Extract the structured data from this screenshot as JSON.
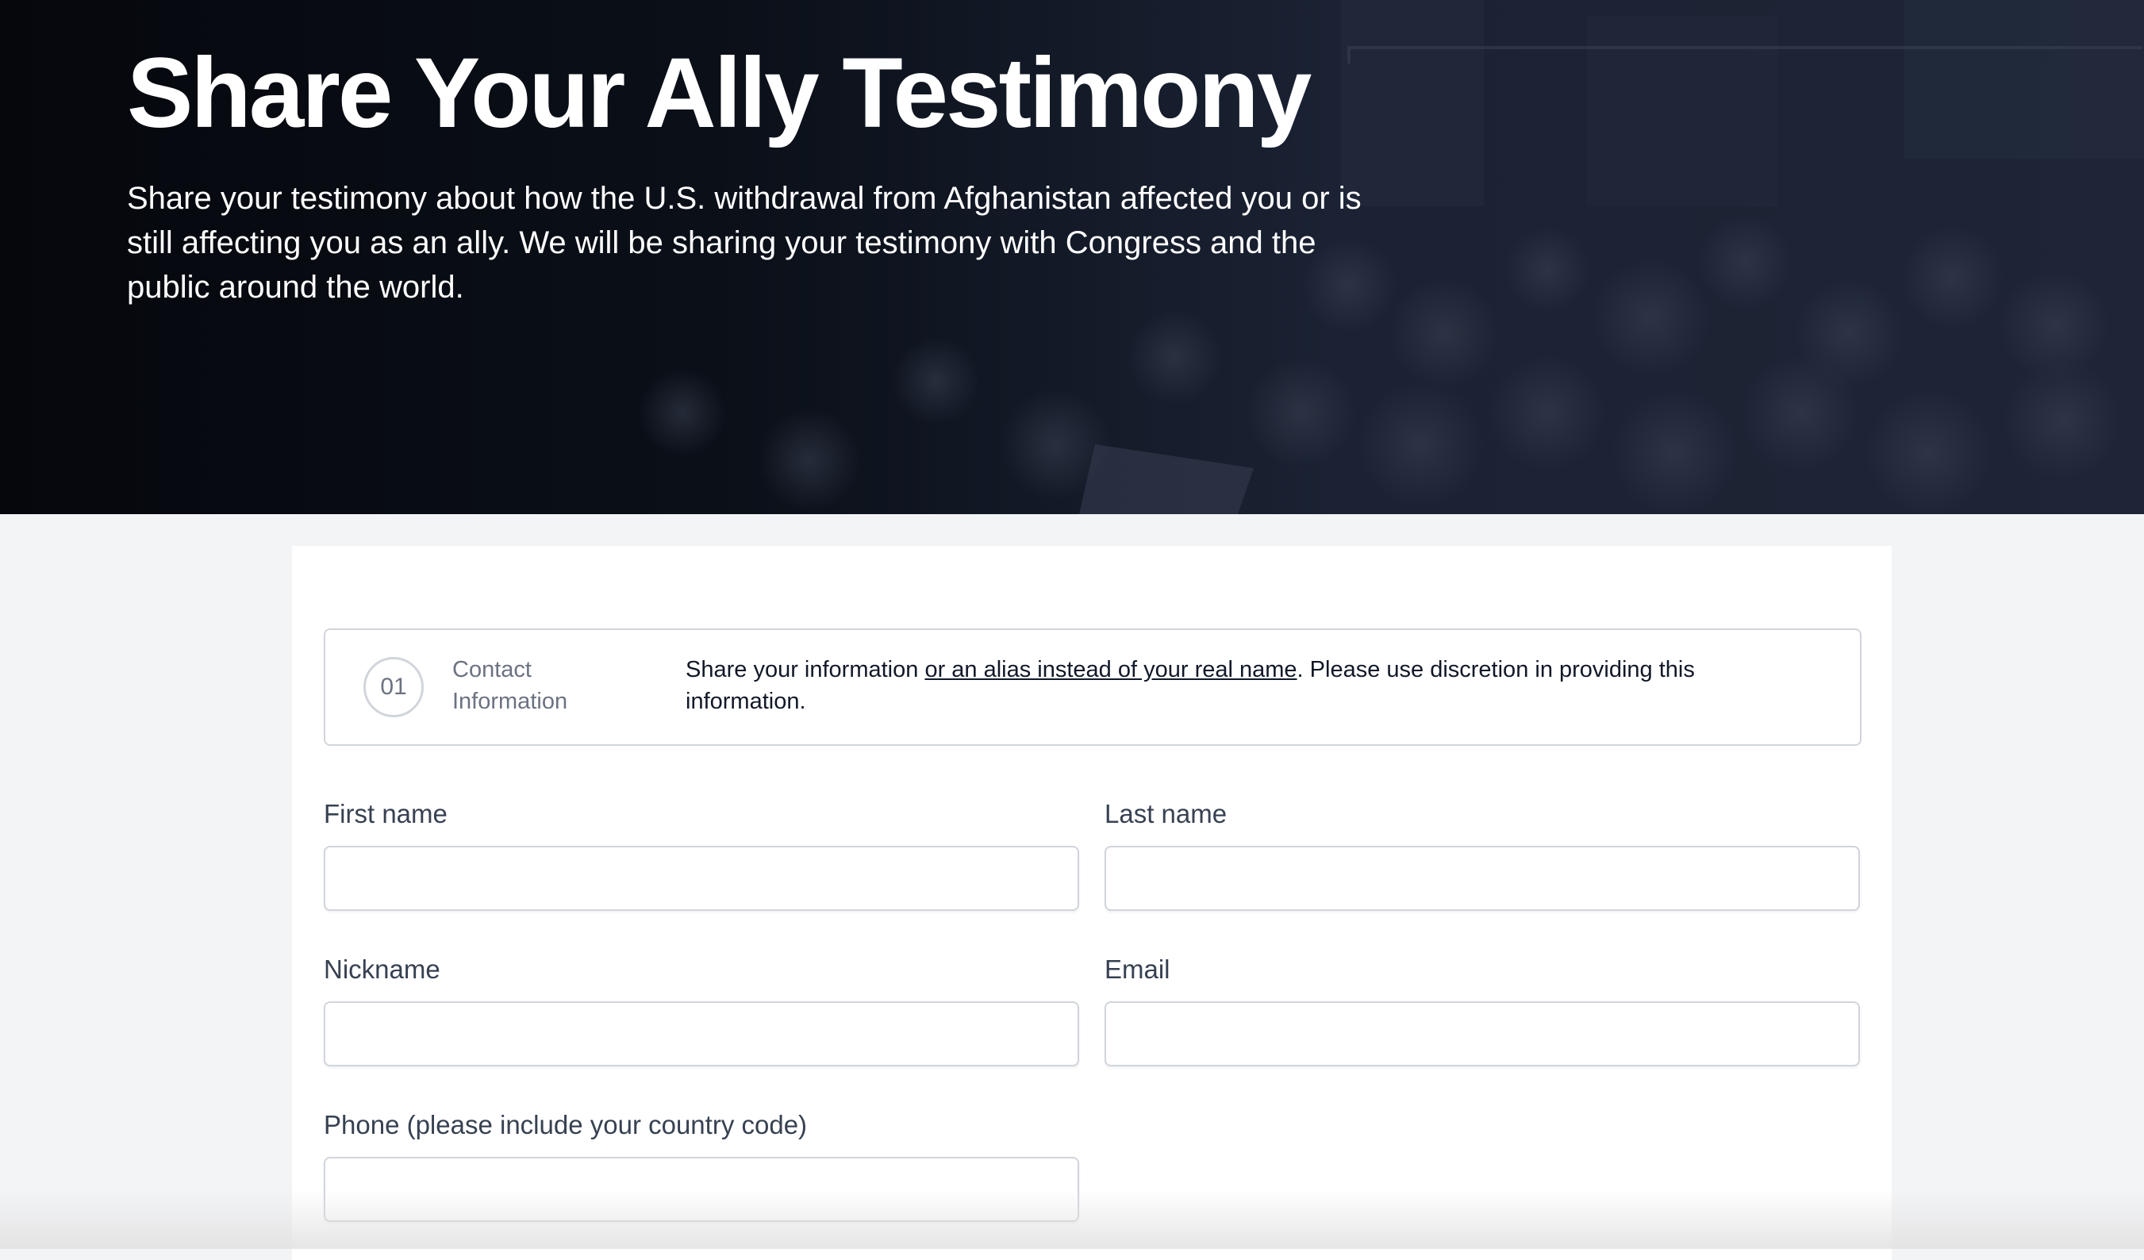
{
  "hero": {
    "title": "Share Your Ally Testimony",
    "subtitle": "Share your testimony about how the U.S. withdrawal from Afghanistan affected you or is still affecting you as an ally. We will be sharing your testimony with Congress and the public around the world."
  },
  "step": {
    "number": "01",
    "label": "Contact Information",
    "description_before": "Share your information ",
    "description_link": "or an alias instead of your real name",
    "description_after": ". Please use discretion in providing this information."
  },
  "fields": {
    "first_name": {
      "label": "First name",
      "value": ""
    },
    "last_name": {
      "label": "Last name",
      "value": ""
    },
    "nickname": {
      "label": "Nickname",
      "value": ""
    },
    "email": {
      "label": "Email",
      "value": ""
    },
    "phone": {
      "label": "Phone (please include your country code)",
      "value": ""
    }
  },
  "colors": {
    "hero_background": "#0b1019",
    "page_background": "#f3f4f6",
    "card_background": "#ffffff",
    "border": "#d1d5db",
    "label_text": "#374151"
  }
}
